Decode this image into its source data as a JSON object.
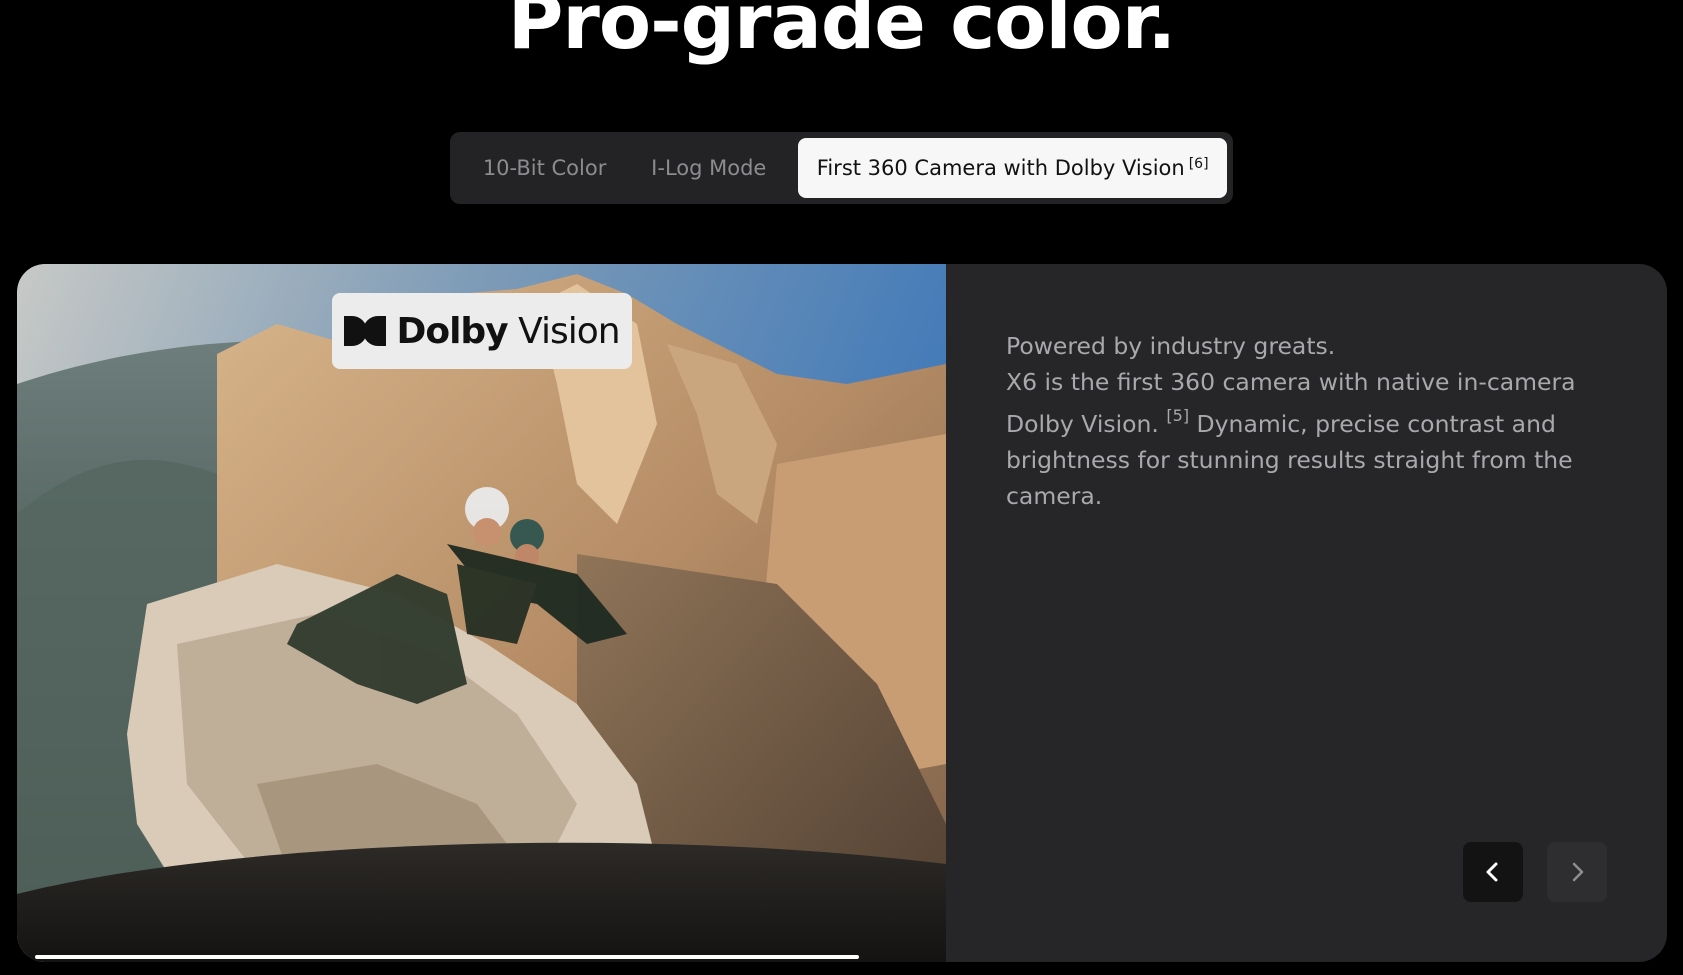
{
  "section": {
    "headline": "Pro-grade color."
  },
  "tabs": [
    {
      "label": "10-Bit Color",
      "active": false
    },
    {
      "label": "I-Log Mode",
      "active": false
    },
    {
      "label": "First 360 Camera with Dolby Vision",
      "footnote": "[6]",
      "active": true
    }
  ],
  "media": {
    "badge_brand": "Dolby",
    "badge_product": "Vision",
    "progress_fraction": 0.95
  },
  "description": {
    "line1": "Powered by industry greats.",
    "line2_before": "X6 is the first 360 camera with native in-camera Dolby Vision.",
    "line2_footnote": "[5]",
    "line2_after": "Dynamic, precise contrast and brightness for stunning results straight from the camera."
  },
  "navigation": {
    "prev_icon": "chevron-left-icon",
    "next_icon": "chevron-right-icon"
  },
  "colors": {
    "background": "#000000",
    "card": "#262628",
    "tab_bar": "#232325",
    "tab_active": "#f7f7f8",
    "text_muted": "#a9a9ad"
  }
}
